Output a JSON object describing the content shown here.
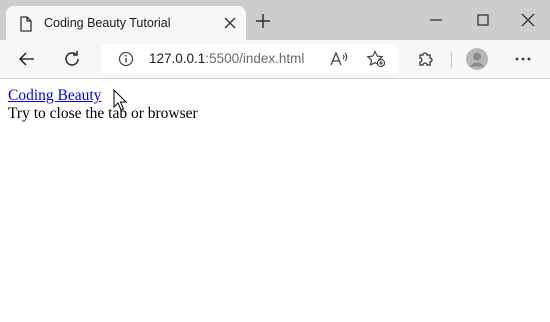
{
  "tab": {
    "title": "Coding Beauty Tutorial"
  },
  "address_bar": {
    "host": "127.0.0.1",
    "rest": ":5500/index.html"
  },
  "page": {
    "link_text": "Coding Beauty",
    "body_text": "Try to close the tab or browser"
  },
  "icons": {
    "tab_page": "page-icon",
    "tab_close": "close-icon",
    "new_tab": "plus-icon",
    "minimize": "minimize-icon",
    "maximize": "maximize-icon",
    "window_close": "close-icon",
    "back": "back-arrow-icon",
    "refresh": "refresh-icon",
    "site_info": "info-icon",
    "read_aloud": "read-aloud-icon",
    "favorites": "favorite-star-icon",
    "extensions": "puzzle-icon",
    "profile": "avatar-icon",
    "more": "more-dots-icon"
  },
  "colors": {
    "tabstrip": "#cdcdcd",
    "toolbar": "#f7f7f7",
    "link": "#0000ee"
  }
}
